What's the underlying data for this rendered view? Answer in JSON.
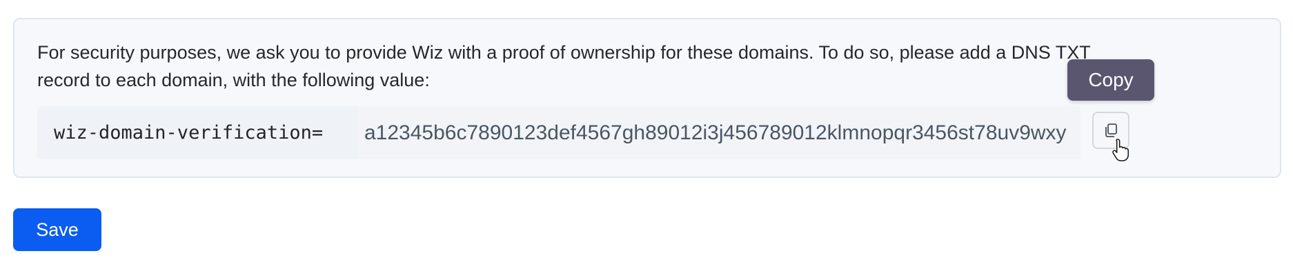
{
  "verification": {
    "instructions": "For security purposes, we ask you to provide Wiz with a proof of ownership for these domains. To do so, please add a DNS TXT record to each domain, with the following value:",
    "record_prefix": "wiz-domain-verification=",
    "record_value": "a12345b6c7890123def4567gh89012i3j456789012klmnopqr3456st78uv9wxy",
    "copy_tooltip": "Copy",
    "copy_icon": "copy-icon"
  },
  "actions": {
    "save_label": "Save"
  },
  "colors": {
    "panel_background": "#f6f8fb",
    "panel_border": "#dde6f2",
    "tooltip_background": "#5a5670",
    "save_button": "#0b5cf0"
  }
}
